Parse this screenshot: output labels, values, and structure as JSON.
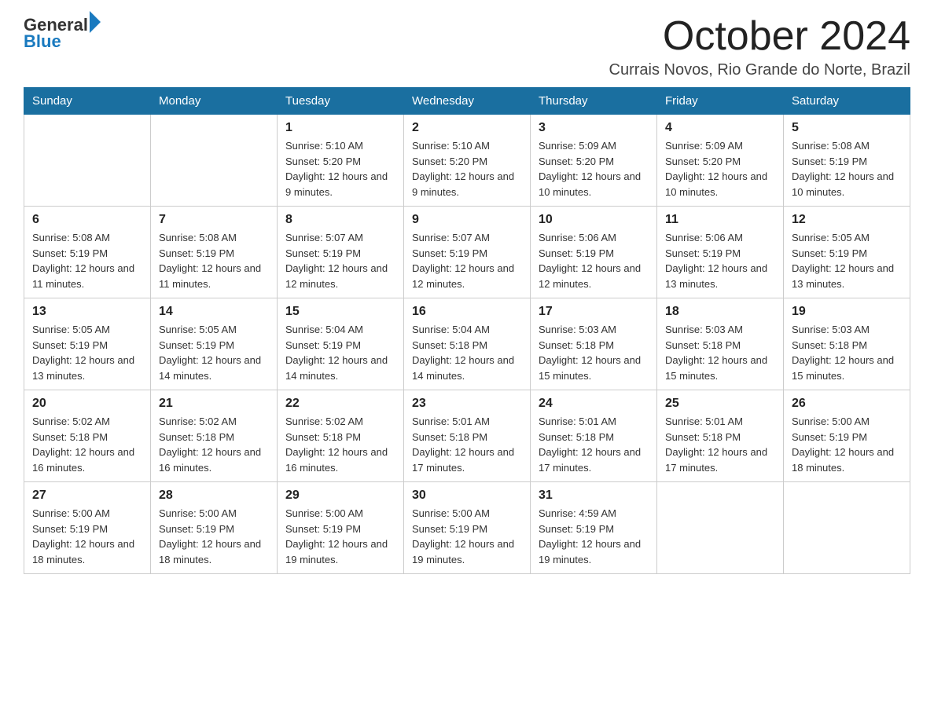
{
  "header": {
    "logo_general": "General",
    "logo_blue": "Blue",
    "month_title": "October 2024",
    "location": "Currais Novos, Rio Grande do Norte, Brazil"
  },
  "days_of_week": [
    "Sunday",
    "Monday",
    "Tuesday",
    "Wednesday",
    "Thursday",
    "Friday",
    "Saturday"
  ],
  "weeks": [
    [
      {
        "day": "",
        "sunrise": "",
        "sunset": "",
        "daylight": ""
      },
      {
        "day": "",
        "sunrise": "",
        "sunset": "",
        "daylight": ""
      },
      {
        "day": "1",
        "sunrise": "Sunrise: 5:10 AM",
        "sunset": "Sunset: 5:20 PM",
        "daylight": "Daylight: 12 hours and 9 minutes."
      },
      {
        "day": "2",
        "sunrise": "Sunrise: 5:10 AM",
        "sunset": "Sunset: 5:20 PM",
        "daylight": "Daylight: 12 hours and 9 minutes."
      },
      {
        "day": "3",
        "sunrise": "Sunrise: 5:09 AM",
        "sunset": "Sunset: 5:20 PM",
        "daylight": "Daylight: 12 hours and 10 minutes."
      },
      {
        "day": "4",
        "sunrise": "Sunrise: 5:09 AM",
        "sunset": "Sunset: 5:20 PM",
        "daylight": "Daylight: 12 hours and 10 minutes."
      },
      {
        "day": "5",
        "sunrise": "Sunrise: 5:08 AM",
        "sunset": "Sunset: 5:19 PM",
        "daylight": "Daylight: 12 hours and 10 minutes."
      }
    ],
    [
      {
        "day": "6",
        "sunrise": "Sunrise: 5:08 AM",
        "sunset": "Sunset: 5:19 PM",
        "daylight": "Daylight: 12 hours and 11 minutes."
      },
      {
        "day": "7",
        "sunrise": "Sunrise: 5:08 AM",
        "sunset": "Sunset: 5:19 PM",
        "daylight": "Daylight: 12 hours and 11 minutes."
      },
      {
        "day": "8",
        "sunrise": "Sunrise: 5:07 AM",
        "sunset": "Sunset: 5:19 PM",
        "daylight": "Daylight: 12 hours and 12 minutes."
      },
      {
        "day": "9",
        "sunrise": "Sunrise: 5:07 AM",
        "sunset": "Sunset: 5:19 PM",
        "daylight": "Daylight: 12 hours and 12 minutes."
      },
      {
        "day": "10",
        "sunrise": "Sunrise: 5:06 AM",
        "sunset": "Sunset: 5:19 PM",
        "daylight": "Daylight: 12 hours and 12 minutes."
      },
      {
        "day": "11",
        "sunrise": "Sunrise: 5:06 AM",
        "sunset": "Sunset: 5:19 PM",
        "daylight": "Daylight: 12 hours and 13 minutes."
      },
      {
        "day": "12",
        "sunrise": "Sunrise: 5:05 AM",
        "sunset": "Sunset: 5:19 PM",
        "daylight": "Daylight: 12 hours and 13 minutes."
      }
    ],
    [
      {
        "day": "13",
        "sunrise": "Sunrise: 5:05 AM",
        "sunset": "Sunset: 5:19 PM",
        "daylight": "Daylight: 12 hours and 13 minutes."
      },
      {
        "day": "14",
        "sunrise": "Sunrise: 5:05 AM",
        "sunset": "Sunset: 5:19 PM",
        "daylight": "Daylight: 12 hours and 14 minutes."
      },
      {
        "day": "15",
        "sunrise": "Sunrise: 5:04 AM",
        "sunset": "Sunset: 5:19 PM",
        "daylight": "Daylight: 12 hours and 14 minutes."
      },
      {
        "day": "16",
        "sunrise": "Sunrise: 5:04 AM",
        "sunset": "Sunset: 5:18 PM",
        "daylight": "Daylight: 12 hours and 14 minutes."
      },
      {
        "day": "17",
        "sunrise": "Sunrise: 5:03 AM",
        "sunset": "Sunset: 5:18 PM",
        "daylight": "Daylight: 12 hours and 15 minutes."
      },
      {
        "day": "18",
        "sunrise": "Sunrise: 5:03 AM",
        "sunset": "Sunset: 5:18 PM",
        "daylight": "Daylight: 12 hours and 15 minutes."
      },
      {
        "day": "19",
        "sunrise": "Sunrise: 5:03 AM",
        "sunset": "Sunset: 5:18 PM",
        "daylight": "Daylight: 12 hours and 15 minutes."
      }
    ],
    [
      {
        "day": "20",
        "sunrise": "Sunrise: 5:02 AM",
        "sunset": "Sunset: 5:18 PM",
        "daylight": "Daylight: 12 hours and 16 minutes."
      },
      {
        "day": "21",
        "sunrise": "Sunrise: 5:02 AM",
        "sunset": "Sunset: 5:18 PM",
        "daylight": "Daylight: 12 hours and 16 minutes."
      },
      {
        "day": "22",
        "sunrise": "Sunrise: 5:02 AM",
        "sunset": "Sunset: 5:18 PM",
        "daylight": "Daylight: 12 hours and 16 minutes."
      },
      {
        "day": "23",
        "sunrise": "Sunrise: 5:01 AM",
        "sunset": "Sunset: 5:18 PM",
        "daylight": "Daylight: 12 hours and 17 minutes."
      },
      {
        "day": "24",
        "sunrise": "Sunrise: 5:01 AM",
        "sunset": "Sunset: 5:18 PM",
        "daylight": "Daylight: 12 hours and 17 minutes."
      },
      {
        "day": "25",
        "sunrise": "Sunrise: 5:01 AM",
        "sunset": "Sunset: 5:18 PM",
        "daylight": "Daylight: 12 hours and 17 minutes."
      },
      {
        "day": "26",
        "sunrise": "Sunrise: 5:00 AM",
        "sunset": "Sunset: 5:19 PM",
        "daylight": "Daylight: 12 hours and 18 minutes."
      }
    ],
    [
      {
        "day": "27",
        "sunrise": "Sunrise: 5:00 AM",
        "sunset": "Sunset: 5:19 PM",
        "daylight": "Daylight: 12 hours and 18 minutes."
      },
      {
        "day": "28",
        "sunrise": "Sunrise: 5:00 AM",
        "sunset": "Sunset: 5:19 PM",
        "daylight": "Daylight: 12 hours and 18 minutes."
      },
      {
        "day": "29",
        "sunrise": "Sunrise: 5:00 AM",
        "sunset": "Sunset: 5:19 PM",
        "daylight": "Daylight: 12 hours and 19 minutes."
      },
      {
        "day": "30",
        "sunrise": "Sunrise: 5:00 AM",
        "sunset": "Sunset: 5:19 PM",
        "daylight": "Daylight: 12 hours and 19 minutes."
      },
      {
        "day": "31",
        "sunrise": "Sunrise: 4:59 AM",
        "sunset": "Sunset: 5:19 PM",
        "daylight": "Daylight: 12 hours and 19 minutes."
      },
      {
        "day": "",
        "sunrise": "",
        "sunset": "",
        "daylight": ""
      },
      {
        "day": "",
        "sunrise": "",
        "sunset": "",
        "daylight": ""
      }
    ]
  ]
}
